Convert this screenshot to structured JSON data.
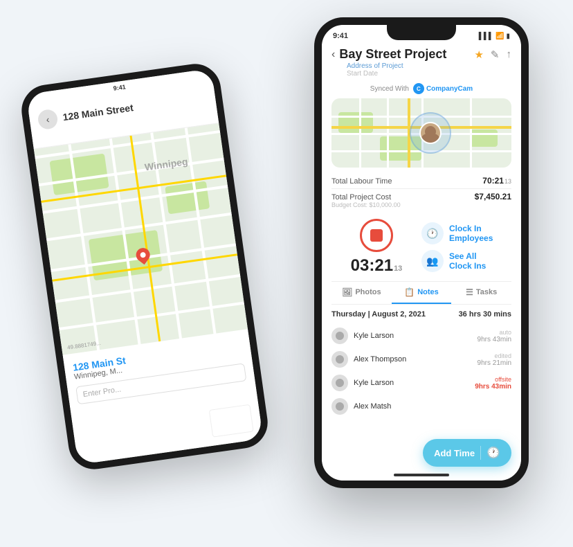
{
  "scene": {
    "background": "#f0f4f8"
  },
  "back_phone": {
    "time": "9:41",
    "address_bar": "128 Main Street",
    "back_btn": "‹",
    "map_label": "Winnipeg",
    "bottom_address": "128 Main St",
    "bottom_city": "Winnipeg, M...",
    "bottom_input_placeholder": "Enter Pro...",
    "bottom_coords": "49.8881749..."
  },
  "front_phone": {
    "time": "9:41",
    "status_signal": "▌▌▌",
    "status_wifi": "WiFi",
    "status_battery": "🔋",
    "header": {
      "back_icon": "‹",
      "title": "Bay Street Project",
      "address_sub": "Address of Project",
      "date_sub": "Start Date",
      "icons": [
        "★",
        "✎",
        "↑"
      ],
      "star_icon": "★",
      "edit_icon": "✎",
      "share_icon": "↑"
    },
    "sync": {
      "label": "Synced With",
      "company_name": "CompanyCam"
    },
    "stats": {
      "labour_label": "Total Labour Time",
      "labour_value": "70:21",
      "labour_count": "13",
      "cost_label": "Total Project Cost",
      "cost_value": "$7,450.21",
      "budget_label": "Budget Cost: $10,000.00"
    },
    "timer": {
      "time": "03:21",
      "count": "13",
      "clock_in_label": "Clock In\nEmployees",
      "see_all_label": "See All\nClock Ins"
    },
    "tabs": [
      {
        "id": "photos",
        "icon": "🖼",
        "label": "Photos"
      },
      {
        "id": "notes",
        "icon": "📋",
        "label": "Notes"
      },
      {
        "id": "tasks",
        "icon": "☰",
        "label": "Tasks"
      }
    ],
    "time_list": {
      "date": "Thursday | August 2, 2021",
      "total": "36 hrs 30 mins",
      "entries": [
        {
          "name": "Kyle Larson",
          "type": "auto",
          "hours": "9hrs 43min"
        },
        {
          "name": "Alex Thompson",
          "type": "edited",
          "hours": "9hrs 21min"
        },
        {
          "name": "Kyle Larson",
          "type": "offsite",
          "hours": "9hrs 43min"
        },
        {
          "name": "Alex Matsh",
          "type": "",
          "hours": ""
        }
      ]
    },
    "add_time_btn": "Add Time"
  }
}
